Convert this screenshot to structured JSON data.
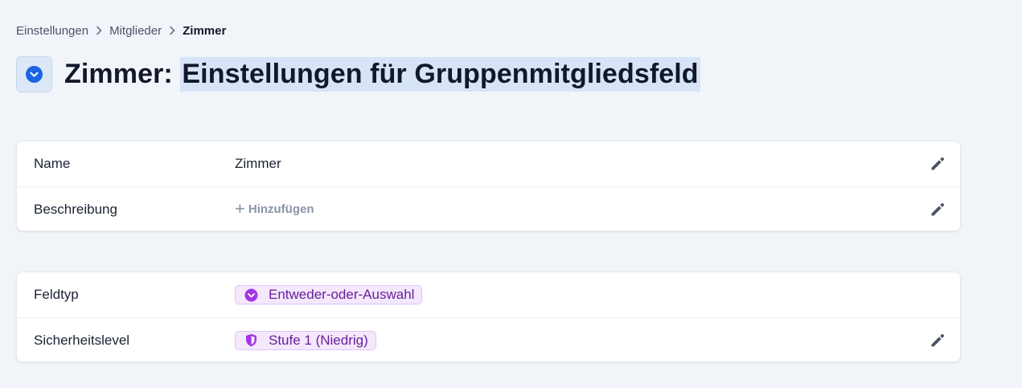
{
  "breadcrumb": {
    "items": [
      "Einstellungen",
      "Mitglieder"
    ],
    "current": "Zimmer"
  },
  "header": {
    "title_prefix": "Zimmer:",
    "title_highlight": "Einstellungen für Gruppenmitgliedsfeld",
    "icon": "chevron-down-circle-icon",
    "accent_color": "#1b66e0"
  },
  "general_card": {
    "rows": [
      {
        "label": "Name",
        "value": "Zimmer"
      },
      {
        "label": "Beschreibung",
        "add_label": "Hinzufügen"
      }
    ]
  },
  "field_card": {
    "rows": [
      {
        "label": "Feldtyp",
        "badge": "Entweder-oder-Auswahl",
        "badge_icon": "chevron-down-circle-icon"
      },
      {
        "label": "Sicherheitslevel",
        "badge": "Stufe 1 (Niedrig)",
        "badge_icon": "shield-icon"
      }
    ],
    "badge_color": "#a335e6"
  }
}
